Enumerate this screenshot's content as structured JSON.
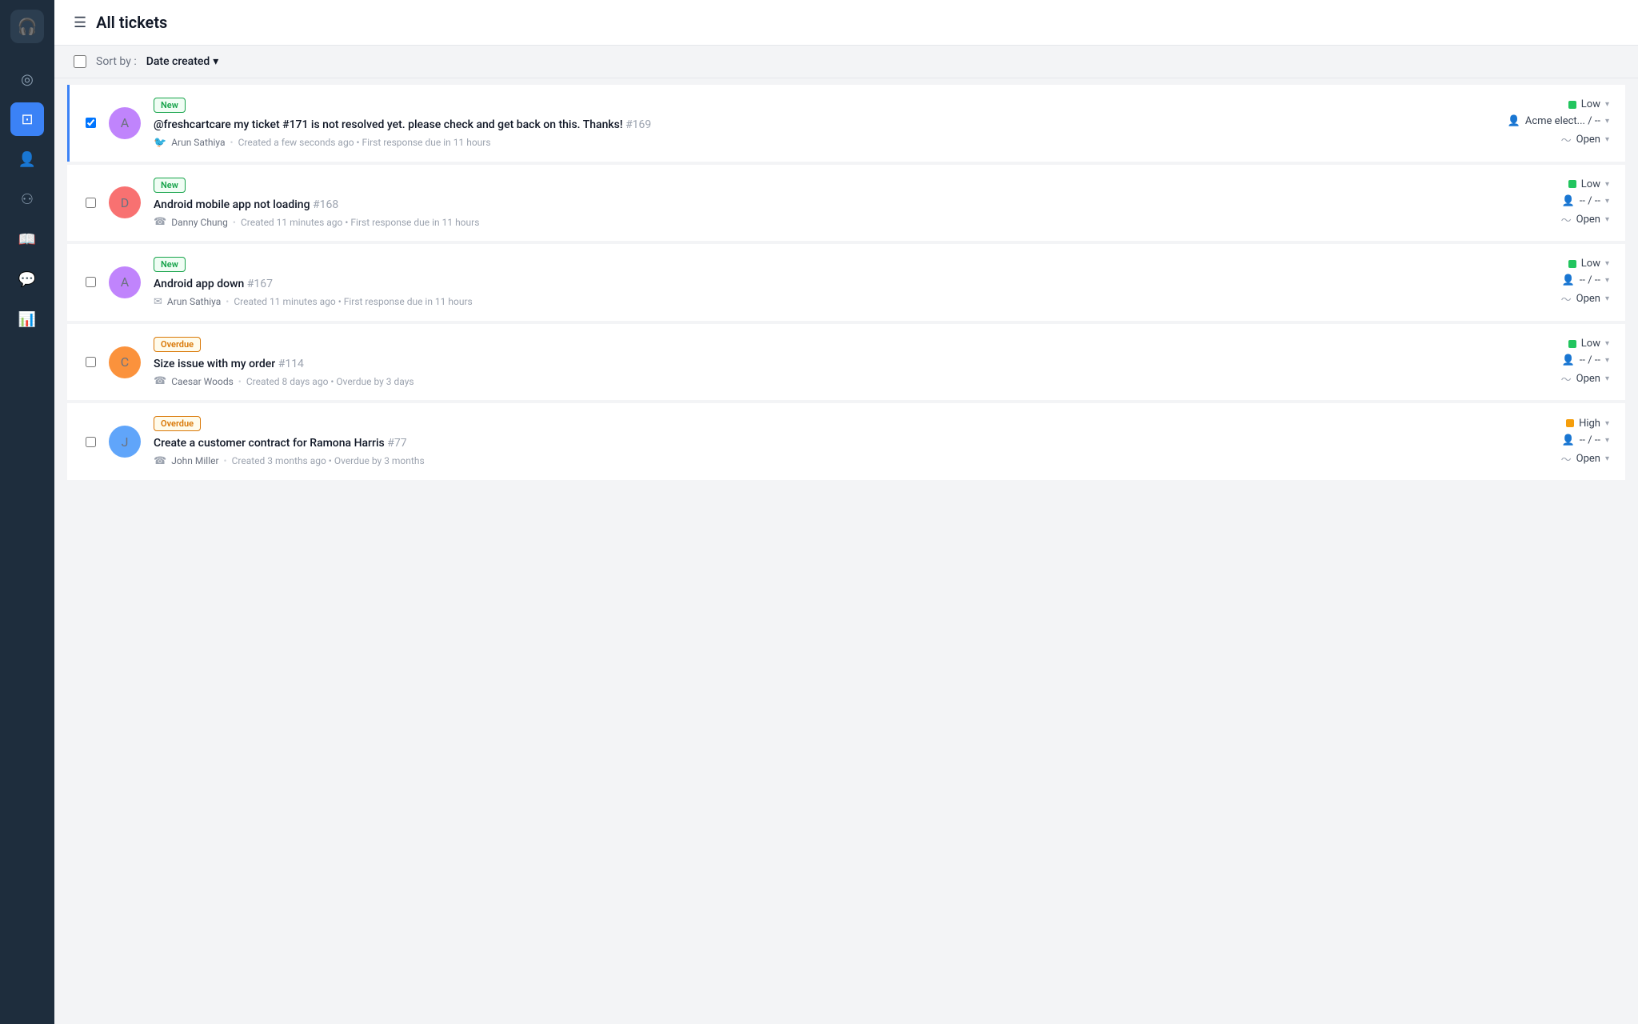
{
  "sidebar": {
    "logo_icon": "🎧",
    "items": [
      {
        "id": "nav-home",
        "icon": "◎",
        "active": false
      },
      {
        "id": "nav-tickets",
        "icon": "⊡",
        "active": true
      },
      {
        "id": "nav-contacts",
        "icon": "👤",
        "active": false
      },
      {
        "id": "nav-reports",
        "icon": "⚙",
        "active": false
      },
      {
        "id": "nav-knowledge",
        "icon": "📖",
        "active": false
      },
      {
        "id": "nav-conversations",
        "icon": "💬",
        "active": false
      },
      {
        "id": "nav-analytics",
        "icon": "📊",
        "active": false
      }
    ]
  },
  "header": {
    "title": "All tickets",
    "menu_icon": "☰"
  },
  "toolbar": {
    "sort_label": "Sort by :",
    "sort_value": "Date created",
    "sort_chevron": "▾"
  },
  "tickets": [
    {
      "id": "ticket-169",
      "badge": "New",
      "badge_type": "new",
      "subject": "@freshcartcare my ticket #171 is not resolved yet. please check and get back on this. Thanks!",
      "ticket_num": "#169",
      "author": "Arun Sathiya",
      "channel_icon": "🐦",
      "meta": "Created a few seconds ago • First response due in 11 hours",
      "priority": "Low",
      "priority_level": "low",
      "assignee": "Acme elect... / --",
      "status": "Open",
      "avatar_class": "av-arun",
      "avatar_letter": "A",
      "selected": true
    },
    {
      "id": "ticket-168",
      "badge": "New",
      "badge_type": "new",
      "subject": "Android mobile app not loading",
      "ticket_num": "#168",
      "author": "Danny Chung",
      "channel_icon": "📞",
      "meta": "Created 11 minutes ago • First response due in 11 hours",
      "priority": "Low",
      "priority_level": "low",
      "assignee": "-- / --",
      "status": "Open",
      "avatar_class": "av-danny",
      "avatar_letter": "D",
      "selected": false
    },
    {
      "id": "ticket-167",
      "badge": "New",
      "badge_type": "new",
      "subject": "Android app down",
      "ticket_num": "#167",
      "author": "Arun Sathiya",
      "channel_icon": "✉",
      "meta": "Created 11 minutes ago • First response due in 11 hours",
      "priority": "Low",
      "priority_level": "low",
      "assignee": "-- / --",
      "status": "Open",
      "avatar_class": "av-arun",
      "avatar_letter": "A",
      "selected": false
    },
    {
      "id": "ticket-114",
      "badge": "Overdue",
      "badge_type": "overdue",
      "subject": "Size issue with my order",
      "ticket_num": "#114",
      "author": "Caesar Woods",
      "channel_icon": "📞",
      "meta": "Created 8 days ago • Overdue by 3 days",
      "priority": "Low",
      "priority_level": "low",
      "assignee": "-- / --",
      "status": "Open",
      "avatar_class": "av-caesar",
      "avatar_letter": "C",
      "selected": false
    },
    {
      "id": "ticket-77",
      "badge": "Overdue",
      "badge_type": "overdue",
      "subject": "Create a customer contract for Ramona Harris",
      "ticket_num": "#77",
      "author": "John Miller",
      "channel_icon": "📞",
      "meta": "Created 3 months ago • Overdue by 3 months",
      "priority": "High",
      "priority_level": "high",
      "assignee": "-- / --",
      "status": "Open",
      "avatar_class": "av-john",
      "avatar_letter": "J",
      "selected": false
    }
  ]
}
